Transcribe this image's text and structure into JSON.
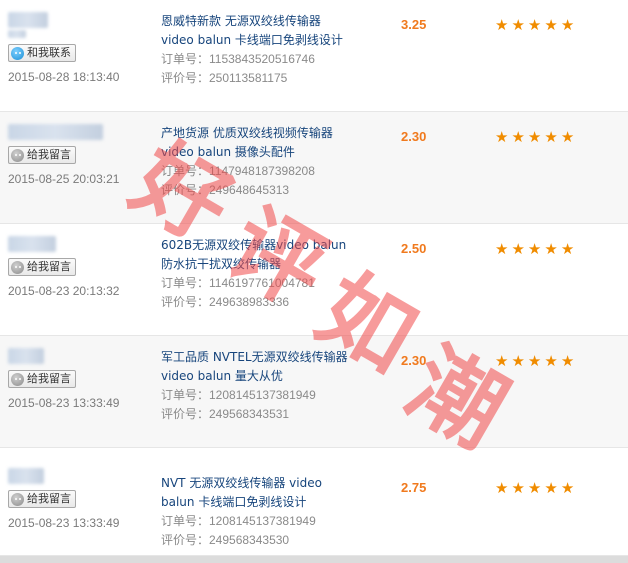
{
  "reviews": [
    {
      "chat_label": "和我联系",
      "chat_icon": "chat-online-icon",
      "time": "2015-08-28 18:13:40",
      "title": "恩威特新款 无源双绞线传输器 video balun 卡线端口免剥线设计",
      "order": "订单号：1153843520516746",
      "review": "评价号：250113581175",
      "score": "3.25",
      "stars": 5
    },
    {
      "chat_label": "给我留言",
      "chat_icon": "chat-offline-icon",
      "time": "2015-08-25 20:03:21",
      "title": "产地货源 优质双绞线视频传输器 video balun 摄像头配件",
      "order": "订单号：1147948187398208",
      "review": "评价号：249648645313",
      "score": "2.30",
      "stars": 5
    },
    {
      "chat_label": "给我留言",
      "chat_icon": "chat-offline-icon",
      "time": "2015-08-23 20:13:32",
      "title": "602B无源双绞传输器video balun 防水抗干扰双绞传输器",
      "order": "订单号：1146197761004781",
      "review": "评价号：249638983336",
      "score": "2.50",
      "stars": 5
    },
    {
      "chat_label": "给我留言",
      "chat_icon": "chat-offline-icon",
      "time": "2015-08-23 13:33:49",
      "title": "军工品质 NVTEL无源双绞线传输器video balun 量大从优",
      "order": "订单号：1208145137381949",
      "review": "评价号：249568343531",
      "score": "2.30",
      "stars": 5
    },
    {
      "chat_label": "给我留言",
      "chat_icon": "chat-offline-icon",
      "time": "2015-08-23 13:33:49",
      "title": "NVT 无源双绞线传输器 video balun 卡线端口免剥线设计",
      "order": "订单号：1208145137381949",
      "review": "评价号：249568343530",
      "score": "2.75",
      "stars": 5
    }
  ],
  "watermark": [
    "好",
    "评",
    "如",
    "潮"
  ],
  "colors": {
    "title": "#17457c",
    "score": "#f07a1e",
    "star": "#f08c00",
    "watermark": "#f04848"
  }
}
